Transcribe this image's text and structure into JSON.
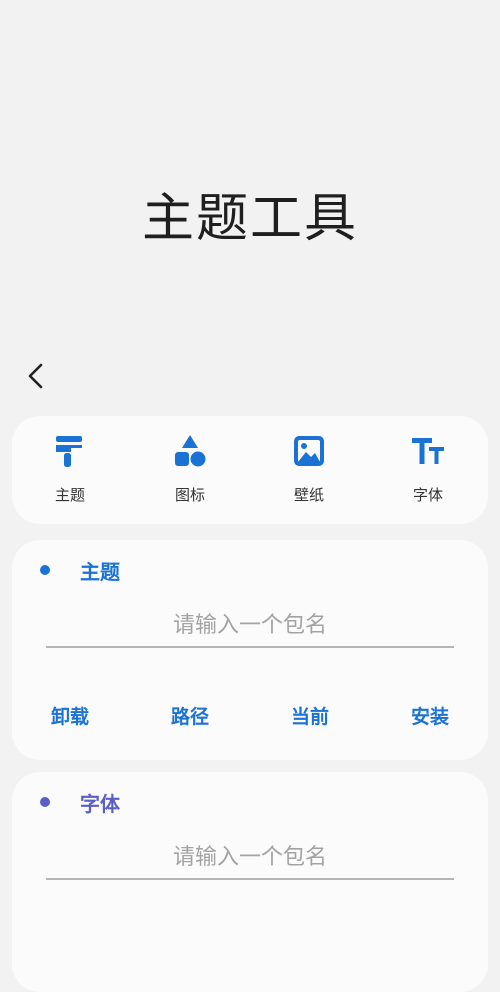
{
  "header": {
    "title": "主题工具"
  },
  "colors": {
    "accent": "#1a73d4",
    "font_accent": "#5a5fc8"
  },
  "tabs": [
    {
      "icon": "paint-roller-icon",
      "label": "主题"
    },
    {
      "icon": "shapes-icon",
      "label": "图标"
    },
    {
      "icon": "image-icon",
      "label": "壁纸"
    },
    {
      "icon": "text-size-icon",
      "label": "字体"
    }
  ],
  "theme_section": {
    "title": "主题",
    "input_value": "",
    "input_placeholder": "请输入一个包名",
    "actions": [
      "卸载",
      "路径",
      "当前",
      "安装"
    ]
  },
  "font_section": {
    "title": "字体",
    "input_value": "",
    "input_placeholder": "请输入一个包名"
  }
}
